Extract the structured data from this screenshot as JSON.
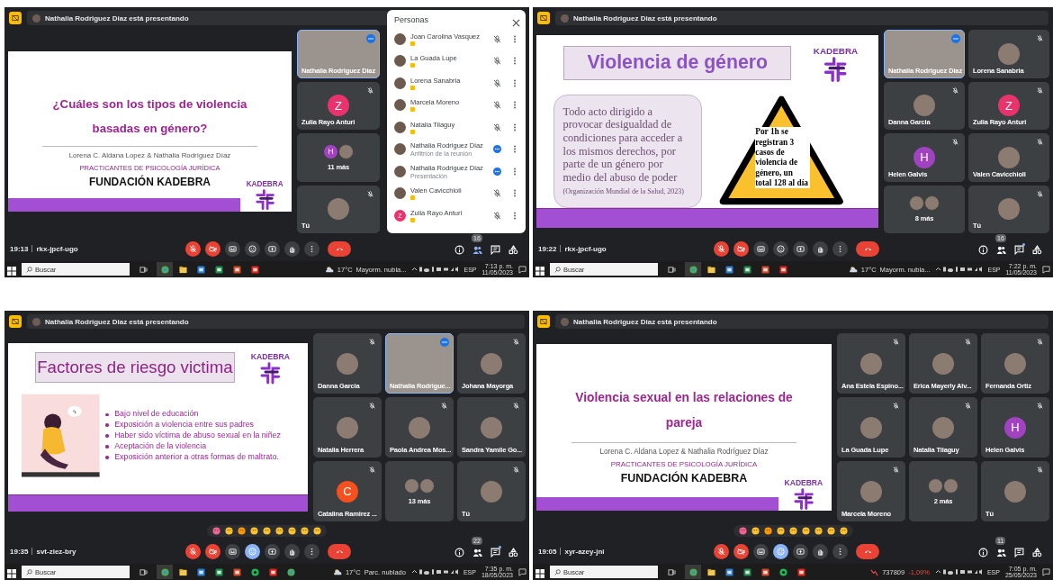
{
  "panels": [
    {
      "banner": "Nathalia Rodriguez Diaz está presentando",
      "slide": {
        "kind": "cover",
        "title": "¿Cuáles son los tipos de violencia basadas en género?",
        "authors": "Lorena C. Aldana Lopez & Nathalia Rodríguez Díaz",
        "subtitle": "PRACTICANTES DE PSICOLOGÍA JURÍDICA",
        "organization": "FUNDACIÓN KADEBRA",
        "logo": "KADEBRA"
      },
      "tiles": [
        {
          "kind": "video",
          "name": "Nathalia Rodriguez Diaz",
          "muted": false,
          "highlighted": true
        },
        {
          "kind": "initial",
          "name": "Zulia Rayo Anturi",
          "initial": "Z",
          "color": "#e8336d",
          "muted": true,
          "highlighted": false
        },
        {
          "kind": "overflow",
          "name": "11 más",
          "initial": "H",
          "color": "#a142c1",
          "muted": false,
          "highlighted": false
        },
        {
          "kind": "photo",
          "name": "Tú",
          "muted": true,
          "highlighted": false
        }
      ],
      "people_panel": {
        "title": "Personas",
        "people": [
          {
            "name": "Joan Carolina Vasquez",
            "muted": true,
            "badge": true
          },
          {
            "name": "La Guada Lupe",
            "muted": true,
            "badge": true
          },
          {
            "name": "Lorena Sanabria",
            "muted": true,
            "badge": true
          },
          {
            "name": "Marcela Moreno",
            "muted": true,
            "badge": true
          },
          {
            "name": "Natalia Tilaguy",
            "muted": true,
            "badge": true
          },
          {
            "name": "Nathalia Rodriguez Diaz",
            "subtitle": "Anfitrión de la reunión",
            "muted": false,
            "badge": false
          },
          {
            "name": "Nathalia Rodriguez Diaz",
            "subtitle": "Presentación",
            "muted": false,
            "badge": false
          },
          {
            "name": "Valen Cavicchioli",
            "muted": true,
            "badge": true
          },
          {
            "name": "Zulia Rayo Anturi",
            "initial": "Z",
            "color": "#e8336d",
            "muted": true,
            "badge": true
          }
        ]
      },
      "controls": {
        "time": "19:13",
        "meeting_code": "rkx-jpcf-ugo",
        "reactions_selected": false,
        "people_selected": true,
        "chat_unread": false,
        "participant_count": "16"
      },
      "taskbar": {
        "search_placeholder": "Buscar",
        "apps": [
          {
            "kind": "chrome",
            "active": true
          },
          {
            "kind": "files",
            "active": false
          },
          {
            "kind": "word",
            "active": false
          },
          {
            "kind": "excel",
            "active": false
          },
          {
            "kind": "powerpoint",
            "active": false
          },
          {
            "kind": "acrobat",
            "active": false
          }
        ],
        "widget": {
          "kind": "weather",
          "value": "17°C",
          "text": "Mayorm. nubla..."
        },
        "language": "ESP",
        "clock_time": "7:13 p. m.",
        "clock_date": "11/05/2023"
      }
    },
    {
      "banner": "Nathalia Rodriguez Diaz está presentando",
      "slide": {
        "kind": "definition",
        "title": "Violencia de género",
        "body": "Todo acto dirigido a provocar desigualdad de condiciones para acceder a los mismos derechos, por parte de un género por medio del abuso de poder",
        "citation": "(Organización Mundial de la Salud, 2023)",
        "warning": "Por 1h se registran 3 casos de violencia de género, un total 128  al día",
        "logo": "KADEBRA"
      },
      "tiles": [
        {
          "kind": "video",
          "name": "Nathalia Rodriguez Diaz",
          "muted": false,
          "highlighted": true
        },
        {
          "kind": "photo",
          "name": "Lorena Sanabria",
          "muted": true,
          "highlighted": false
        },
        {
          "kind": "photo",
          "name": "Danna Garcia",
          "muted": true,
          "highlighted": false
        },
        {
          "kind": "initial",
          "name": "Zulia Rayo Anturi",
          "initial": "Z",
          "color": "#e8336d",
          "muted": true,
          "highlighted": false
        },
        {
          "kind": "initial",
          "name": "Helen Galvis",
          "initial": "H",
          "color": "#a142c1",
          "muted": true,
          "highlighted": false
        },
        {
          "kind": "photo",
          "name": "Valen Cavicchioli",
          "muted": true,
          "highlighted": false
        },
        {
          "kind": "overflow",
          "name": "8 más",
          "muted": false,
          "highlighted": false
        },
        {
          "kind": "photo",
          "name": "Tú",
          "muted": true,
          "highlighted": false
        }
      ],
      "controls": {
        "time": "19:22",
        "meeting_code": "rkx-jpcf-ugo",
        "reactions_selected": false,
        "people_selected": false,
        "chat_unread": true,
        "participant_count": "16"
      },
      "taskbar": {
        "search_placeholder": "Buscar",
        "apps": [
          {
            "kind": "chrome",
            "active": true
          },
          {
            "kind": "files",
            "active": false
          },
          {
            "kind": "word",
            "active": false
          },
          {
            "kind": "excel",
            "active": false
          },
          {
            "kind": "powerpoint",
            "active": false
          },
          {
            "kind": "acrobat",
            "active": false
          }
        ],
        "widget": {
          "kind": "weather",
          "value": "17°C",
          "text": "Mayorm. nubla..."
        },
        "language": "ESP",
        "clock_time": "7:22 p. m.",
        "clock_date": "11/05/2023"
      }
    },
    {
      "banner": "Nathalia Rodriguez Diaz está presentando",
      "slide": {
        "kind": "list",
        "title": "Factores de riesgo victima",
        "items": [
          "Bajo nivel de educación",
          "Exposición a violencia entre sus padres",
          "Haber sido víctima de abuso sexual en la niñez",
          "Aceptación de la violencia",
          "Exposición anterior a otras formas de maltrato."
        ],
        "logo": "KADEBRA"
      },
      "tiles": [
        {
          "kind": "photo",
          "name": "Danna Garcia",
          "muted": true,
          "highlighted": false
        },
        {
          "kind": "video",
          "name": "Nathalia Rodrigue...",
          "muted": false,
          "highlighted": true
        },
        {
          "kind": "photo",
          "name": "Johana Mayorga",
          "muted": true,
          "highlighted": false
        },
        {
          "kind": "photo",
          "name": "Natalia Herrera",
          "muted": true,
          "highlighted": false
        },
        {
          "kind": "photo",
          "name": "Paola Andrea Mos...",
          "muted": true,
          "highlighted": false
        },
        {
          "kind": "photo",
          "name": "Sandra Yamile Go...",
          "muted": true,
          "highlighted": false
        },
        {
          "kind": "initial",
          "name": "Catalina Ramirez ...",
          "initial": "C",
          "color": "#f4511e",
          "muted": true,
          "highlighted": false
        },
        {
          "kind": "overflow",
          "name": "13 más",
          "muted": false,
          "highlighted": false
        },
        {
          "kind": "photo",
          "name": "Tú",
          "muted": true,
          "highlighted": false
        }
      ],
      "reaction_bar_visible": true,
      "controls": {
        "time": "19:35",
        "meeting_code": "svt-ziez-bry",
        "reactions_selected": true,
        "people_selected": false,
        "chat_unread": true,
        "participant_count": "22"
      },
      "taskbar": {
        "search_placeholder": "Buscar",
        "apps": [
          {
            "kind": "chrome",
            "active": true
          },
          {
            "kind": "files",
            "active": false
          },
          {
            "kind": "word",
            "active": false
          },
          {
            "kind": "excel",
            "active": false
          },
          {
            "kind": "powerpoint",
            "active": false
          },
          {
            "kind": "spotify",
            "active": false
          },
          {
            "kind": "acrobat",
            "active": false
          },
          {
            "kind": "chrome",
            "active": false
          }
        ],
        "widget": {
          "kind": "weather",
          "value": "17°C",
          "text": "Parc. nublado"
        },
        "language": "ESP",
        "clock_time": "7:35 p. m.",
        "clock_date": "18/05/2023"
      }
    },
    {
      "banner": "Nathalia Rodriguez Diaz está presentando",
      "slide": {
        "kind": "cover",
        "title": "Violencia sexual en las relaciones de pareja",
        "authors": "Lorena C. Aldana Lopez & Nathalia Rodríguez Díaz",
        "subtitle": "PRACTICANTES DE PSICOLOGÍA JURÍDICA",
        "organization": "FUNDACIÓN KADEBRA",
        "logo": "KADEBRA"
      },
      "tiles": [
        {
          "kind": "photo",
          "name": "Ana Estela Espino...",
          "muted": true,
          "highlighted": false
        },
        {
          "kind": "photo",
          "name": "Erica Mayerly Alv...",
          "muted": true,
          "highlighted": false
        },
        {
          "kind": "photo",
          "name": "Fernanda Ortiz",
          "muted": true,
          "highlighted": false
        },
        {
          "kind": "photo",
          "name": "La Guada Lupe",
          "muted": true,
          "highlighted": false
        },
        {
          "kind": "photo",
          "name": "Natalia Tilaguy",
          "muted": true,
          "highlighted": false
        },
        {
          "kind": "initial",
          "name": "Helen Galvis",
          "initial": "H",
          "color": "#a142c1",
          "muted": true,
          "highlighted": false
        },
        {
          "kind": "photo",
          "name": "Marcela Moreno",
          "muted": true,
          "highlighted": false
        },
        {
          "kind": "overflow",
          "name": "2 más",
          "muted": false,
          "highlighted": false
        },
        {
          "kind": "photo",
          "name": "Tú",
          "muted": true,
          "highlighted": false
        }
      ],
      "reaction_bar_visible": true,
      "controls": {
        "time": "19:05",
        "meeting_code": "xyr-azey-jni",
        "reactions_selected": true,
        "people_selected": false,
        "chat_unread": false,
        "participant_count": "11"
      },
      "taskbar": {
        "search_placeholder": "Buscar",
        "apps": [
          {
            "kind": "chrome",
            "active": true
          },
          {
            "kind": "files",
            "active": false
          },
          {
            "kind": "word",
            "active": false
          },
          {
            "kind": "excel",
            "active": false
          },
          {
            "kind": "powerpoint",
            "active": false
          },
          {
            "kind": "spotify",
            "active": false
          },
          {
            "kind": "acrobat",
            "active": false
          }
        ],
        "widget": {
          "kind": "stock",
          "value": "737809",
          "text": "-1,09%"
        },
        "language": "ESP",
        "clock_time": "7:05 p. m.",
        "clock_date": "25/05/2023"
      }
    }
  ]
}
